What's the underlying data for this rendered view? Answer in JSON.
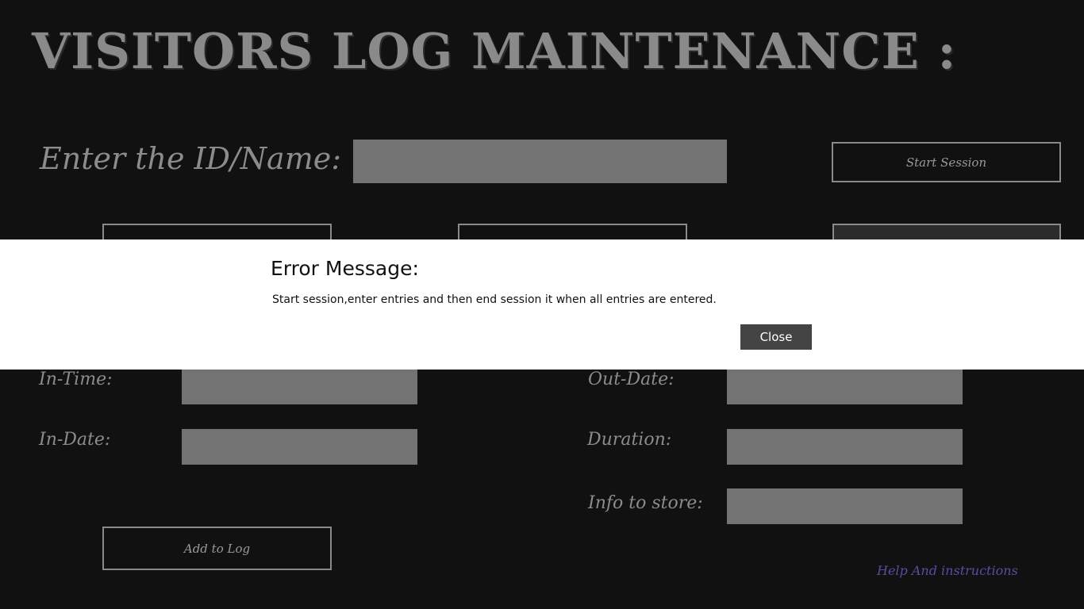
{
  "header": {
    "title": "VISITORS LOG MAINTENANCE :"
  },
  "id_entry": {
    "label": "Enter the ID/Name:",
    "value": "",
    "start_button": "Start Session"
  },
  "action_buttons": {
    "left": "",
    "middle": "",
    "right": ""
  },
  "form": {
    "in_time_label": "In-Time:",
    "in_date_label": "In-Date:",
    "out_date_label": "Out-Date:",
    "duration_label": "Duration:",
    "info_label": "Info to store:",
    "add_button": "Add to Log"
  },
  "help_link": "Help And instructions",
  "dialog": {
    "title": "Error Message:",
    "message": "Start session,enter entries and then end session it when all entries are entered.",
    "close_label": "Close"
  },
  "colors": {
    "background": "#111111",
    "field": "#737373",
    "label": "#8c8c8c",
    "link": "#5e4aa0",
    "dialog_background": "#ffffff",
    "dialog_button": "#444444"
  }
}
